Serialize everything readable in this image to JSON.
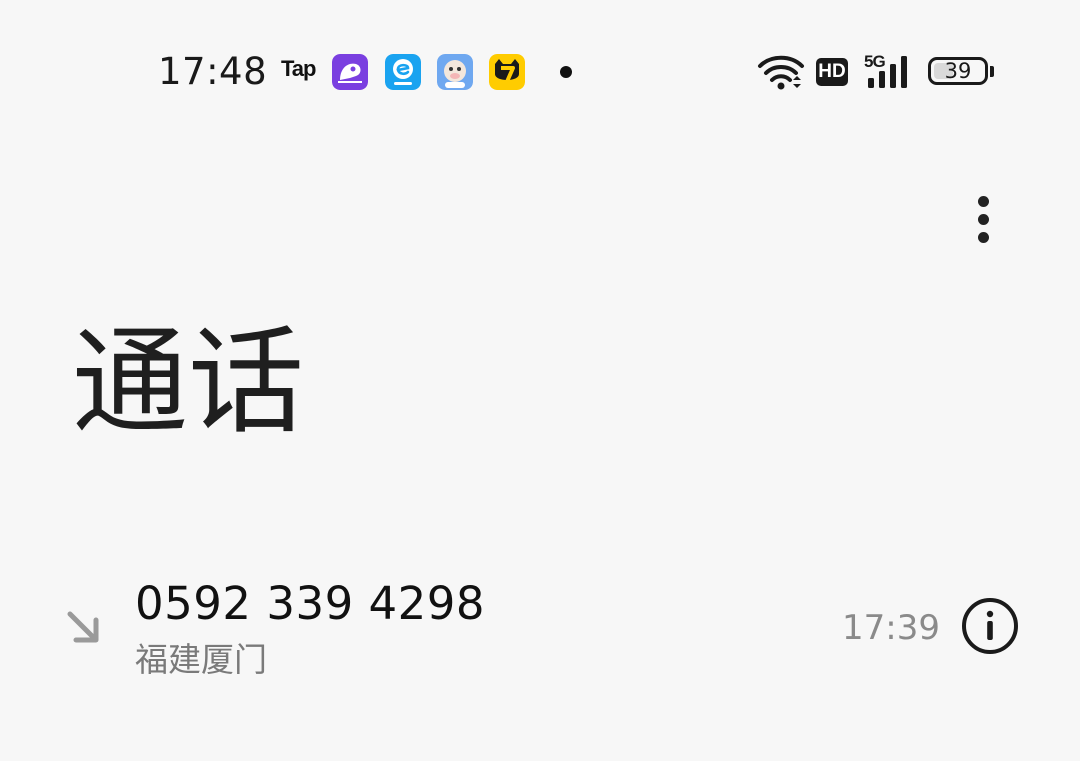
{
  "status_bar": {
    "time": "17:48",
    "notification_icons": [
      "taptap-icon",
      "purple-app-icon",
      "eleme-icon",
      "blue-cartoon-app-icon",
      "qimao-novel-icon"
    ],
    "tap_label": "Tap",
    "hd_label": "HD",
    "network_label": "5G",
    "battery_level": "39",
    "battery_fraction": 0.39
  },
  "header": {
    "title": "通话",
    "more_icon": "more-vert-icon"
  },
  "call_log": [
    {
      "number": "0592 339 4298",
      "location": "福建厦门",
      "time": "17:39",
      "type_icon": "incoming-call-arrow-icon",
      "info_icon": "info-icon"
    }
  ],
  "colors": {
    "background": "#f7f7f7",
    "primary_text": "#1f1f1f",
    "secondary_text": "#7a7a7a",
    "purple_app": "#7a3fe0",
    "eleme_blue": "#1aa3f0",
    "qimao_yellow": "#ffcc00"
  }
}
